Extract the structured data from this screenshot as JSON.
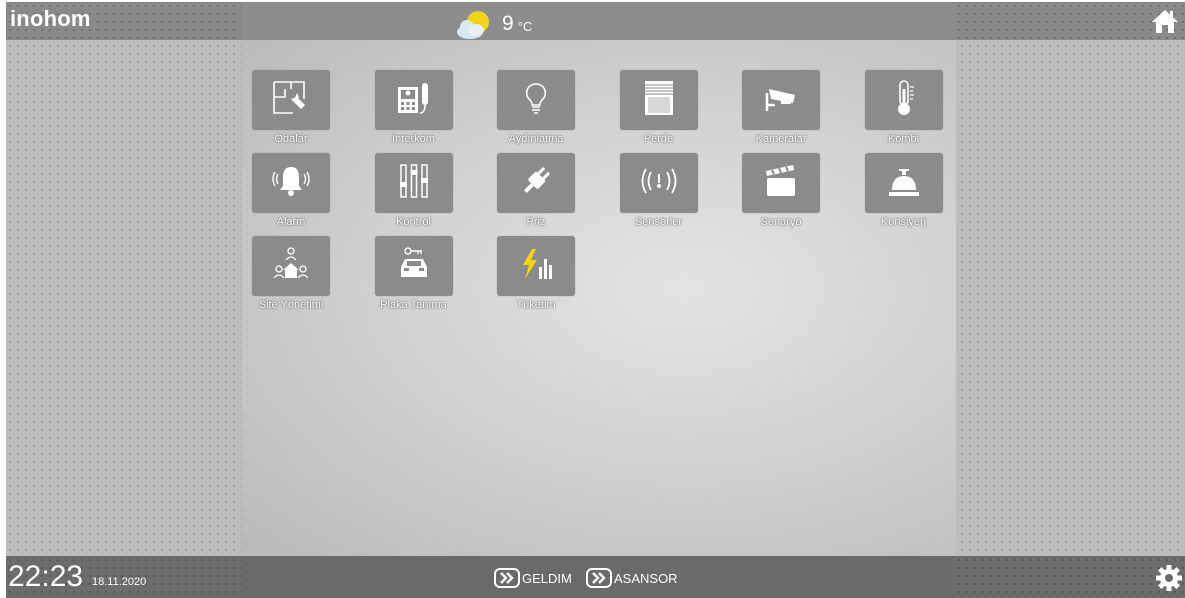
{
  "header": {
    "brand": "inohom",
    "weather": {
      "icon": "partly-cloudy-icon",
      "temperature": "9",
      "unit": "°C"
    },
    "home_icon": "home-icon"
  },
  "menu": [
    {
      "label": "Odalar",
      "icon": "floorplan-icon"
    },
    {
      "label": "İnterkom",
      "icon": "intercom-icon"
    },
    {
      "label": "Aydınlatma",
      "icon": "lightbulb-icon"
    },
    {
      "label": "Perde",
      "icon": "curtain-icon"
    },
    {
      "label": "Kameralar",
      "icon": "camera-icon"
    },
    {
      "label": "Kombi",
      "icon": "thermometer-icon"
    },
    {
      "label": "Alarm",
      "icon": "alarm-bell-icon"
    },
    {
      "label": "Kontrol",
      "icon": "sliders-icon"
    },
    {
      "label": "Priz",
      "icon": "plug-icon"
    },
    {
      "label": "Sensörler",
      "icon": "sensor-icon"
    },
    {
      "label": "Senaryo",
      "icon": "clapperboard-icon"
    },
    {
      "label": "Konsiyerj",
      "icon": "service-bell-icon"
    },
    {
      "label": "Site Yönetimi",
      "icon": "community-icon"
    },
    {
      "label": "Plaka Tanıma",
      "icon": "car-key-icon"
    },
    {
      "label": "Tüketim",
      "icon": "energy-usage-icon"
    }
  ],
  "footer": {
    "time": "22:23",
    "date": "18.11.2020",
    "actions": [
      {
        "label": "GELDIM",
        "icon": "double-chevron-icon"
      },
      {
        "label": "ASANSOR",
        "icon": "double-chevron-icon"
      }
    ],
    "settings_icon": "gear-icon"
  },
  "colors": {
    "accent_yellow": "#f5d21a",
    "tile": "#8b8b8b",
    "bar": "#6a6a6a"
  }
}
